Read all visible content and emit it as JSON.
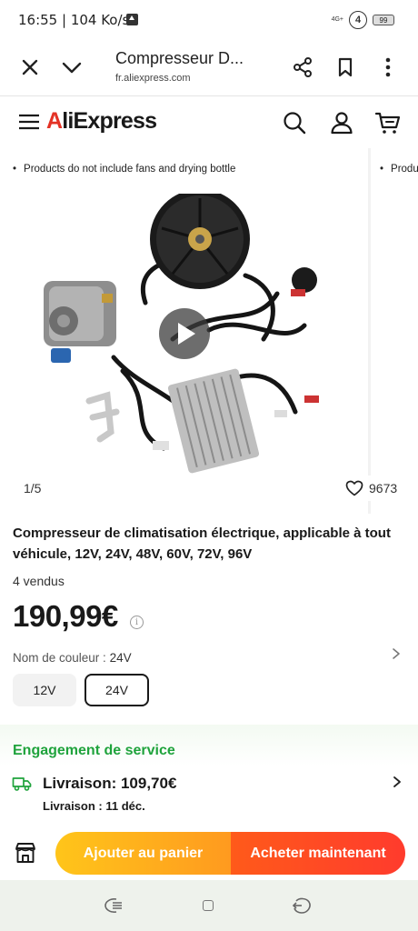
{
  "status_bar": {
    "time_speed": "16:55 | 104 Ko/s",
    "network": "4G+",
    "signal_badge": "4",
    "battery": "99"
  },
  "browser": {
    "tab_title": "Compresseur D...",
    "url": "fr.aliexpress.com"
  },
  "header": {
    "logo_first": "A",
    "logo_rest": "liExpress",
    "brand_color": "#e43225"
  },
  "gallery": {
    "note": "Products do not include fans and drying bottle",
    "note_next": "Produ",
    "counter": "1/5",
    "wishlist_count": "9673"
  },
  "product": {
    "title": "Compresseur de climatisation électrique, applicable à tout véhicule, 12V, 24V, 48V, 60V, 72V, 96V",
    "sold": "4 vendus",
    "price": "190,99€",
    "color_label": "Nom de couleur : ",
    "color_value": "24V",
    "options": [
      "12V",
      "24V"
    ],
    "selected_option": "24V"
  },
  "service": {
    "title": "Engagement de service",
    "title_color": "#1fa33c",
    "delivery": "Livraison: 109,70€",
    "date_label": "Livraison : ",
    "date_value": "11 déc."
  },
  "actions": {
    "add_to_cart": "Ajouter au panier",
    "buy_now": "Acheter maintenant"
  },
  "icons": [
    "close-icon",
    "chevron-down-icon",
    "share-icon",
    "bookmark-icon",
    "more-vertical-icon",
    "hamburger-icon",
    "search-icon",
    "account-icon",
    "cart-icon",
    "play-icon",
    "heart-icon",
    "info-icon",
    "chevron-right-icon",
    "truck-icon",
    "store-icon",
    "nav-menu-icon",
    "nav-home-icon",
    "nav-back-icon"
  ]
}
